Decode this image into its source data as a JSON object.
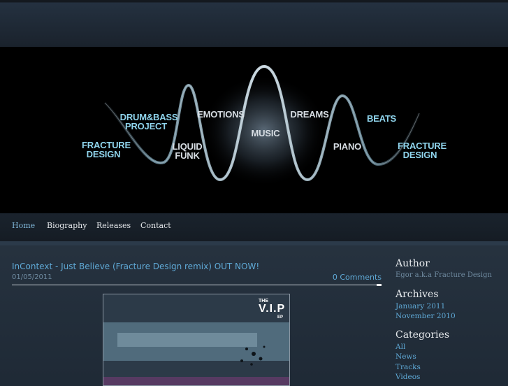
{
  "banner": {
    "words": [
      {
        "text": "FRACTURE",
        "color": "cyan"
      },
      {
        "text": "DESIGN",
        "color": "cyan"
      },
      {
        "text": "DRUM&BASS",
        "color": "cyan"
      },
      {
        "text": "PROJECT",
        "color": "cyan"
      },
      {
        "text": "LIQUID",
        "color": "white"
      },
      {
        "text": "FUNK",
        "color": "white"
      },
      {
        "text": "EMOTIONS",
        "color": "white"
      },
      {
        "text": "MUSIC",
        "color": "white"
      },
      {
        "text": "DREAMS",
        "color": "white"
      },
      {
        "text": "PIANO",
        "color": "white"
      },
      {
        "text": "BEATS",
        "color": "cyan"
      },
      {
        "text": "FRACTURE",
        "color": "cyan"
      },
      {
        "text": "DESIGN",
        "color": "cyan"
      }
    ]
  },
  "nav": {
    "items": [
      {
        "label": "Home",
        "active": true
      },
      {
        "label": "Biography",
        "active": false
      },
      {
        "label": "Releases",
        "active": false
      },
      {
        "label": "Contact",
        "active": false
      }
    ]
  },
  "post": {
    "title": "InContext - Just Believe (Fracture Design remix) OUT NOW!",
    "date": "01/05/2011",
    "comments": "0 Comments",
    "cover": {
      "the": "THE",
      "vip": "V.I.P",
      "ep": "EP"
    }
  },
  "sidebar": {
    "author": {
      "heading": "Author",
      "text": "Egor a.k.a Fracture Design"
    },
    "archives": {
      "heading": "Archives",
      "links": [
        "January 2011",
        "November 2010"
      ]
    },
    "categories": {
      "heading": "Categories",
      "links": [
        "All",
        "News",
        "Tracks",
        "Videos"
      ]
    }
  },
  "colors": {
    "background": "#1f2a36",
    "link": "#5fa9d6",
    "nav_active": "#7fb6d8",
    "banner_cyan": "#8fd4ec"
  }
}
